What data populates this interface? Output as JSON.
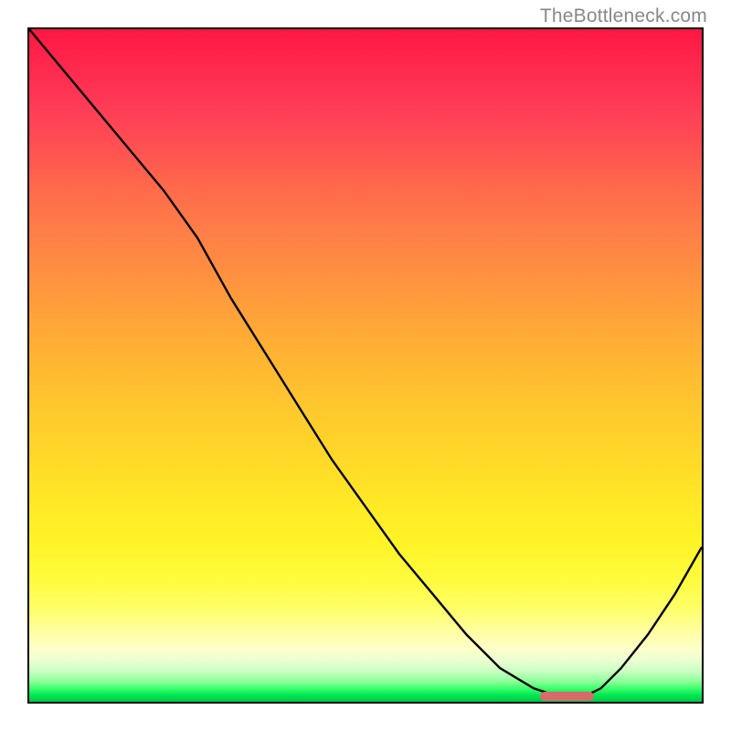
{
  "watermark": "TheBottleneck.com",
  "chart_data": {
    "type": "line",
    "title": "",
    "xlabel": "",
    "ylabel": "",
    "xlim": [
      0,
      100
    ],
    "ylim": [
      0,
      100
    ],
    "grid": false,
    "legend": false,
    "gradient_stops": [
      {
        "pos": 0,
        "color": "#ff1744"
      },
      {
        "pos": 50,
        "color": "#ffb531"
      },
      {
        "pos": 82,
        "color": "#fffb3e"
      },
      {
        "pos": 92,
        "color": "#ffffc8"
      },
      {
        "pos": 97,
        "color": "#8aff9a"
      },
      {
        "pos": 100,
        "color": "#00c846"
      }
    ],
    "series": [
      {
        "name": "bottleneck-curve",
        "x": [
          0,
          5,
          10,
          15,
          20,
          25,
          30,
          35,
          40,
          45,
          50,
          55,
          60,
          65,
          70,
          75,
          78,
          80,
          83,
          85,
          88,
          92,
          96,
          100
        ],
        "y": [
          100,
          94,
          88,
          82,
          76,
          69,
          60,
          52,
          44,
          36,
          29,
          22,
          16,
          10,
          5,
          2,
          1,
          1,
          1,
          2,
          5,
          10,
          16,
          23
        ]
      }
    ],
    "marker": {
      "x_start": 76,
      "x_end": 84,
      "y": 0.8
    }
  }
}
